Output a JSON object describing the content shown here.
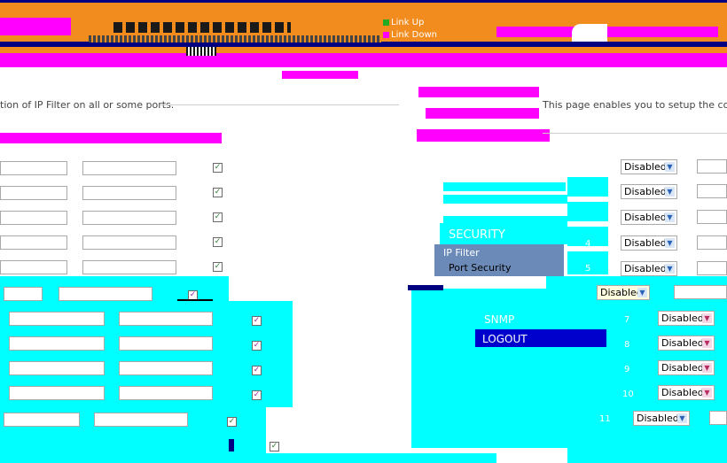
{
  "header": {
    "legend_link_up": "Link Up",
    "legend_link_down": "Link Down",
    "colors": {
      "link_up": "#22aa22",
      "link_down": "#ff00ff"
    }
  },
  "left_panel": {
    "description": "tion of IP Filter on all or some ports."
  },
  "right_panel": {
    "description": "This page enables you to setup the configura"
  },
  "nav": {
    "items": [
      {
        "label": "SECURITY"
      },
      {
        "label": "IP Filter"
      },
      {
        "label": "Port Security"
      },
      {
        "label": "SNMP"
      },
      {
        "label": "LOGOUT"
      }
    ]
  },
  "port_rows": [
    {
      "port": "",
      "status": "Disabled"
    },
    {
      "port": "",
      "status": "Disabled"
    },
    {
      "port": "",
      "status": "Disabled"
    },
    {
      "port": "4",
      "status": "Disabled"
    },
    {
      "port": "5",
      "status": "Disabled"
    },
    {
      "port": "",
      "status": "Disabled"
    },
    {
      "port": "7",
      "status": "Disabled"
    },
    {
      "port": "8",
      "status": "Disabled"
    },
    {
      "port": "9",
      "status": "Disabled"
    },
    {
      "port": "10",
      "status": "Disabled"
    },
    {
      "port": "11",
      "status": "Disabled"
    }
  ]
}
